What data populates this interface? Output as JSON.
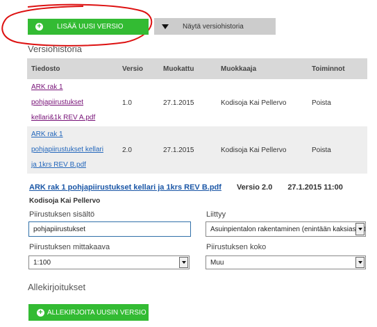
{
  "toolbar": {
    "add_version_label": "LISÄÄ UUSI VERSIO",
    "show_history_label": "Näytä versiohistoria"
  },
  "history": {
    "title": "Versiohistoria",
    "columns": [
      "Tiedosto",
      "Versio",
      "Muokattu",
      "Muokkaaja",
      "Toiminnot"
    ],
    "rows": [
      {
        "file_lines": [
          "ARK rak 1",
          "pohjapiirustukset",
          "kellari&1k REV A.pdf"
        ],
        "version": "1.0",
        "modified": "27.1.2015",
        "editor": "Kodisoja Kai Pellervo",
        "action": "Poista"
      },
      {
        "file_lines": [
          "ARK rak 1",
          "pohjapiirustukset kellari",
          "ja 1krs REV B.pdf"
        ],
        "version": "2.0",
        "modified": "27.1.2015",
        "editor": "Kodisoja Kai Pellervo",
        "action": "Poista"
      }
    ]
  },
  "detail": {
    "file_link": "ARK rak 1 pohjapiirustukset kellari ja 1krs REV B.pdf",
    "version": "Versio 2.0",
    "datetime": "27.1.2015 11:00",
    "user": "Kodisoja Kai Pellervo"
  },
  "form": {
    "content_label": "Piirustuksen sisältö",
    "content_value": "pohjapiirustukset",
    "attach_label": "Liittyy",
    "attach_value": "Asuinpientalon rakentaminen (enintään kaksiasuntoinen)",
    "scale_label": "Piirustuksen mittakaava",
    "scale_value": "1:100",
    "size_label": "Piirustuksen koko",
    "size_value": "Muu"
  },
  "signatures": {
    "title": "Allekirjoitukset",
    "sign_label": "ALLEKIRJOITA UUSIN VERSIO"
  },
  "colors": {
    "accent_green": "#33bb33",
    "annotation_red": "#dd1111"
  }
}
